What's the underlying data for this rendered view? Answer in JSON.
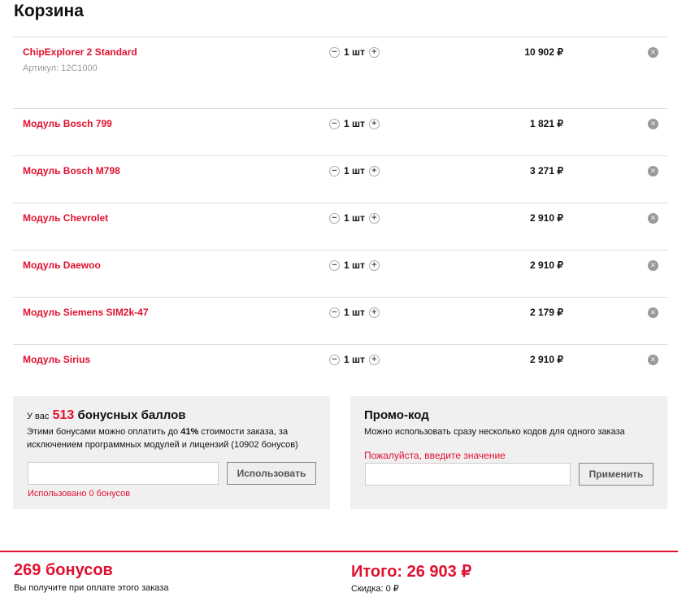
{
  "title": "Корзина",
  "items": [
    {
      "name": "ChipExplorer 2 Standard",
      "sku": "Артикул: 12C1000",
      "qty": "1 шт",
      "price": "10 902 ₽"
    },
    {
      "name": "Модуль Bosch 799",
      "qty": "1 шт",
      "price": "1 821 ₽"
    },
    {
      "name": "Модуль Bosch M798",
      "qty": "1 шт",
      "price": "3 271 ₽"
    },
    {
      "name": "Модуль Chevrolet",
      "qty": "1 шт",
      "price": "2 910 ₽"
    },
    {
      "name": "Модуль Daewoo",
      "qty": "1 шт",
      "price": "2 910 ₽"
    },
    {
      "name": "Модуль Siemens SIM2k-47",
      "qty": "1 шт",
      "price": "2 179 ₽"
    },
    {
      "name": "Модуль Sirius",
      "qty": "1 шт",
      "price": "2 910 ₽"
    }
  ],
  "bonus": {
    "prefix": "У вас",
    "count": "513",
    "suffix": "бонусных баллов",
    "desc1": "Этими бонусами можно оплатить до ",
    "percent": "41%",
    "desc2": " стоимости заказа, за исключением программных модулей и лицензий (10902 бонусов)",
    "button": "Использовать",
    "used": "Использовано 0 бонусов"
  },
  "promo": {
    "title": "Промо-код",
    "desc": "Можно использовать сразу несколько кодов для одного заказа",
    "error": "Пожалуйста, введите значение",
    "button": "Применить"
  },
  "footer": {
    "bonuses": "269 бонусов",
    "bonuses_note": "Вы получите при оплате этого заказа",
    "total": "Итого: 26 903 ₽",
    "discount": "Скидка: 0 ₽"
  }
}
